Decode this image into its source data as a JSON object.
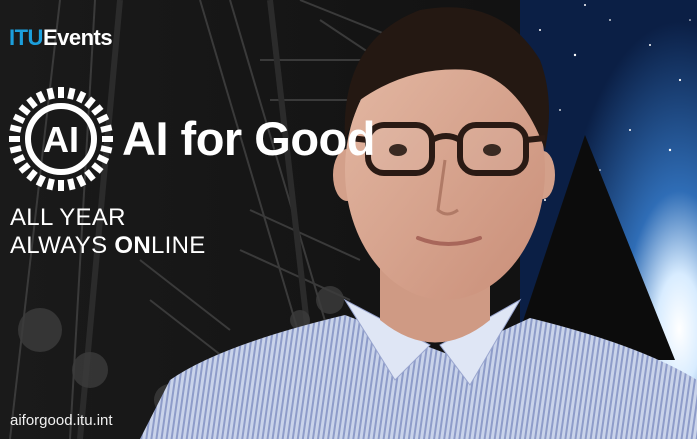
{
  "branding": {
    "itu_prefix": "ITU",
    "itu_suffix": "Events",
    "ai_emblem_text": "AI",
    "title": "AI for Good",
    "tagline_line1": "ALL YEAR",
    "tagline_line2_a": "ALWAYS ",
    "tagline_line2_b": "ON",
    "tagline_line2_c": "LINE",
    "website": "aiforgood.itu.int"
  },
  "colors": {
    "itu_blue": "#1c9fdc",
    "background_dark": "#121212",
    "space_blue": "#1e4f8f",
    "text_white": "#ffffff"
  },
  "scene": {
    "subject": "person-webcam-speaker",
    "subject_accessories": [
      "glasses-icon"
    ],
    "clothing": "striped-shirt"
  }
}
